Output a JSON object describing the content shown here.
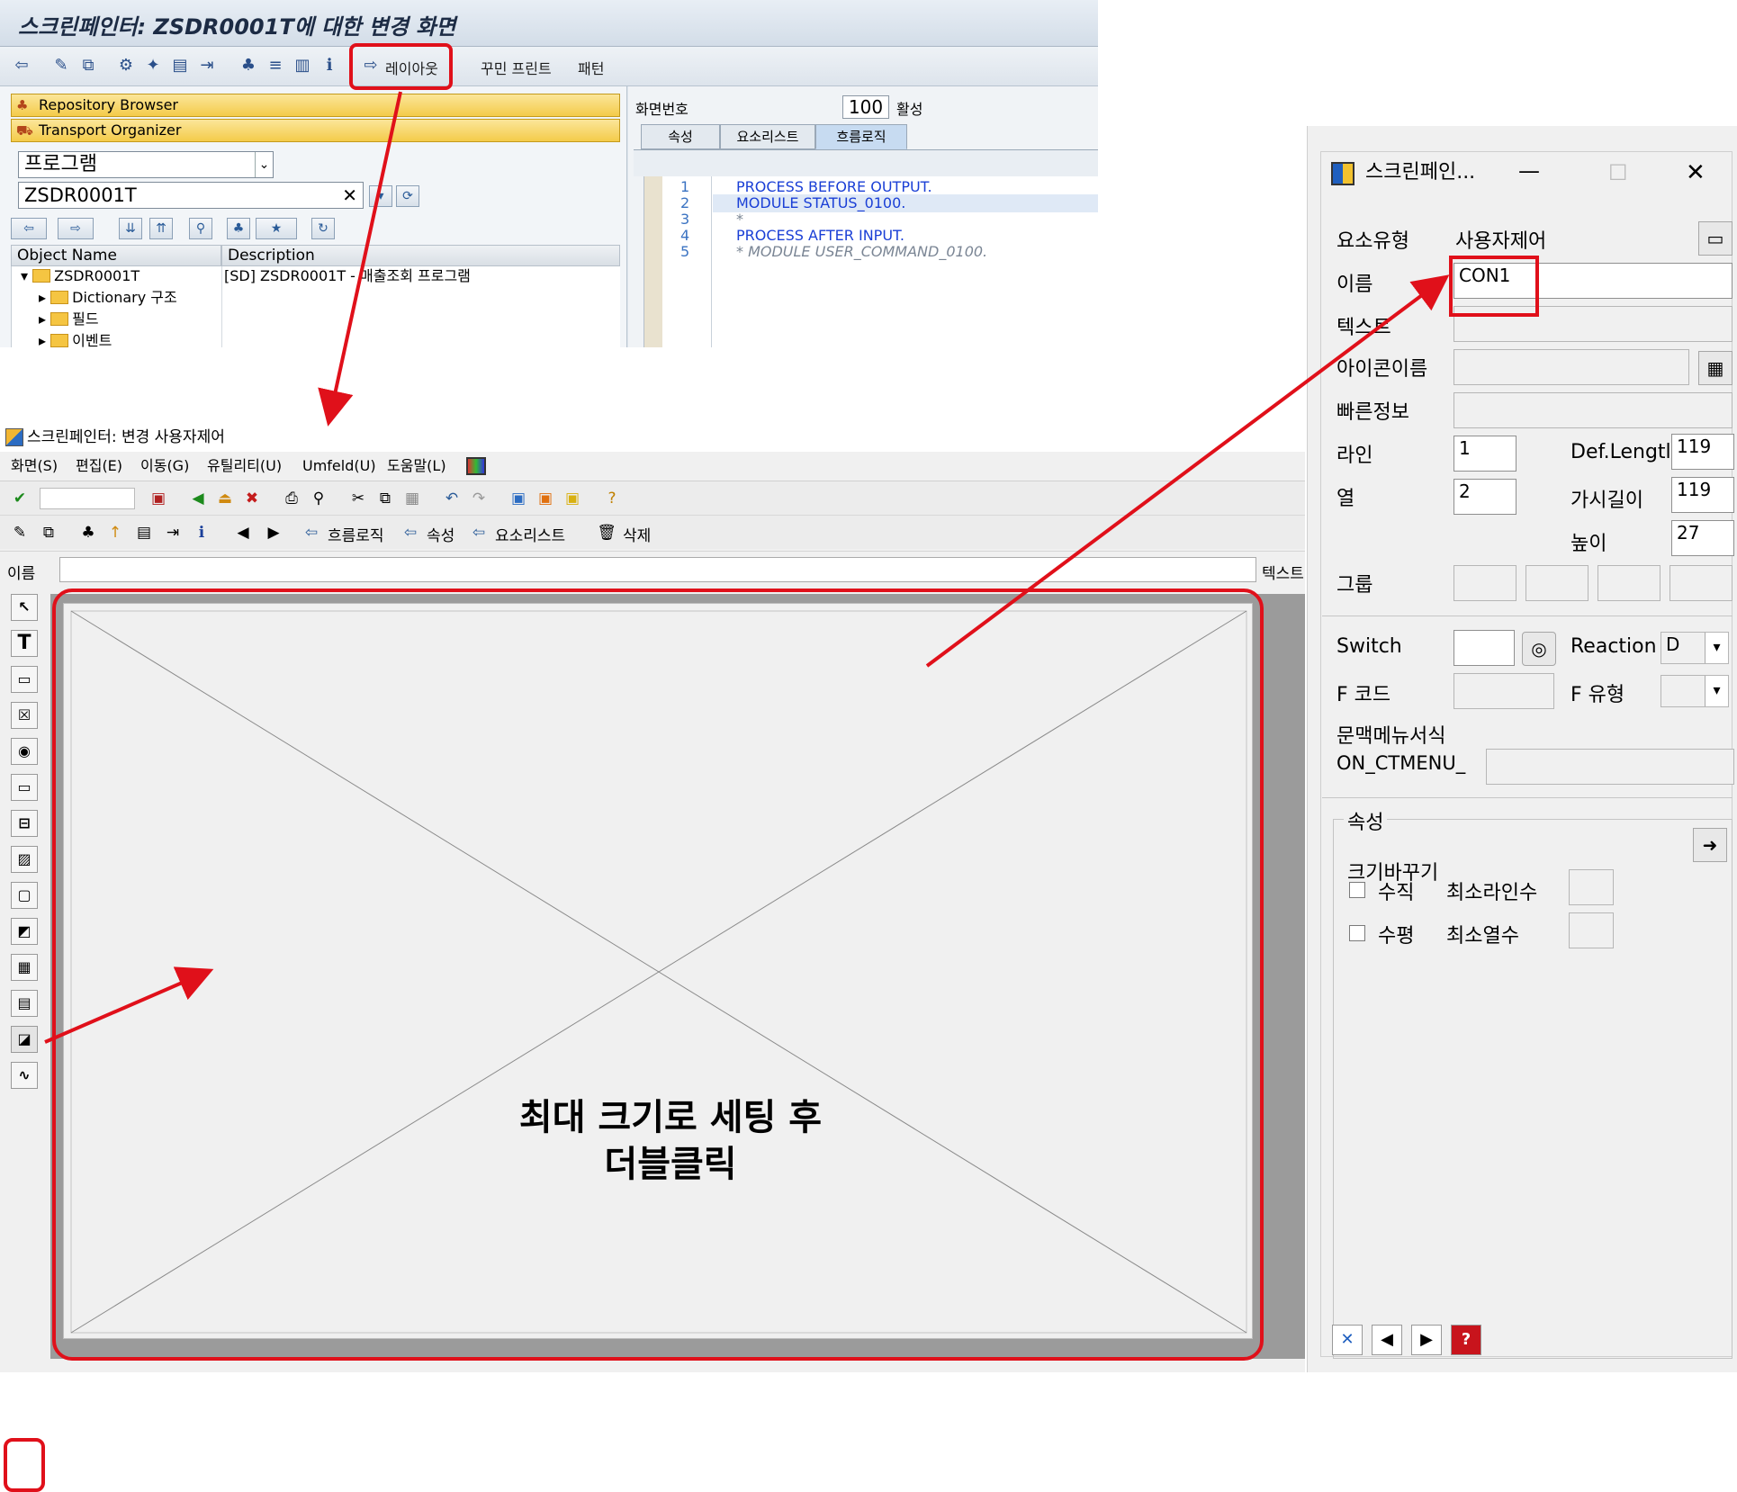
{
  "top_window": {
    "title": "스크린페인터: ZSDR0001T에 대한 변경 화면",
    "toolbar_layout": "레이아웃",
    "toolbar_pretty_print": "꾸민 프린트",
    "toolbar_pattern": "패턴",
    "repository_browser": "Repository Browser",
    "transport_organizer": "Transport Organizer",
    "object_type": "프로그램",
    "object_name": "ZSDR0001T",
    "clear_x": "✕",
    "col_object_name": "Object Name",
    "col_description": "Description",
    "tree": [
      {
        "name": "ZSDR0001T",
        "desc": "[SD] ZSDR0001T - 매출조회 프로그램"
      },
      {
        "name": "Dictionary 구조"
      },
      {
        "name": "필드"
      },
      {
        "name": "이벤트"
      }
    ],
    "screen_number_label": "화면번호",
    "screen_number": "100",
    "status": "활성",
    "tabs": [
      "속성",
      "요소리스트",
      "흐름로직"
    ],
    "code_lines": [
      {
        "no": "1",
        "text": "PROCESS BEFORE OUTPUT."
      },
      {
        "no": "2",
        "text": " MODULE STATUS_0100."
      },
      {
        "no": "3",
        "text": "*"
      },
      {
        "no": "4",
        "text": "PROCESS AFTER INPUT."
      },
      {
        "no": "5",
        "text": "* MODULE USER_COMMAND_0100."
      }
    ]
  },
  "main_window": {
    "title": "스크린페인터:  변경 사용자제어",
    "menu": [
      "화면(S)",
      "편집(E)",
      "이동(G)",
      "유틸리티(U)",
      "Umfeld(U)",
      "도움말(L)"
    ],
    "toolbar2": {
      "flow_logic": "흐름로직",
      "attributes": "속성",
      "element_list": "요소리스트",
      "delete": "삭제"
    },
    "name_label": "이름",
    "text_label": "텍스트",
    "annotation_line1": "최대 크기로 세팅 후",
    "annotation_line2": "더블클릭"
  },
  "dialog": {
    "title": "스크린페인...",
    "element_type_label": "요소유형",
    "element_type": "사용자제어",
    "name_label": "이름",
    "name_value": "CON1",
    "text_label": "텍스트",
    "icon_name_label": "아이콘이름",
    "quick_info_label": "빠른정보",
    "line_label": "라인",
    "line_value": "1",
    "column_label": "열",
    "column_value": "2",
    "def_length_label": "Def.Lengtl",
    "def_length_value": "119",
    "visible_length_label": "가시길이",
    "visible_length_value": "119",
    "height_label": "높이",
    "height_value": "27",
    "group_label": "그룹",
    "switch_label": "Switch",
    "reaction_label": "Reaction",
    "reaction_value": "D",
    "fcode_label": "F 코드",
    "ftype_label": "F 유형",
    "context_menu_label": "문맥메뉴서식",
    "context_menu_prefix": "ON_CTMENU_",
    "attributes_group": "속성",
    "resize_label": "크기바꾸기",
    "vertical_label": "수직",
    "min_lines_label": "최소라인수",
    "horizontal_label": "수평",
    "min_cols_label": "최소열수"
  },
  "colors": {
    "highlight_red": "#e0101a",
    "sap_blue": "#2a5b98",
    "repository_yellow": "#f4cb4a"
  }
}
